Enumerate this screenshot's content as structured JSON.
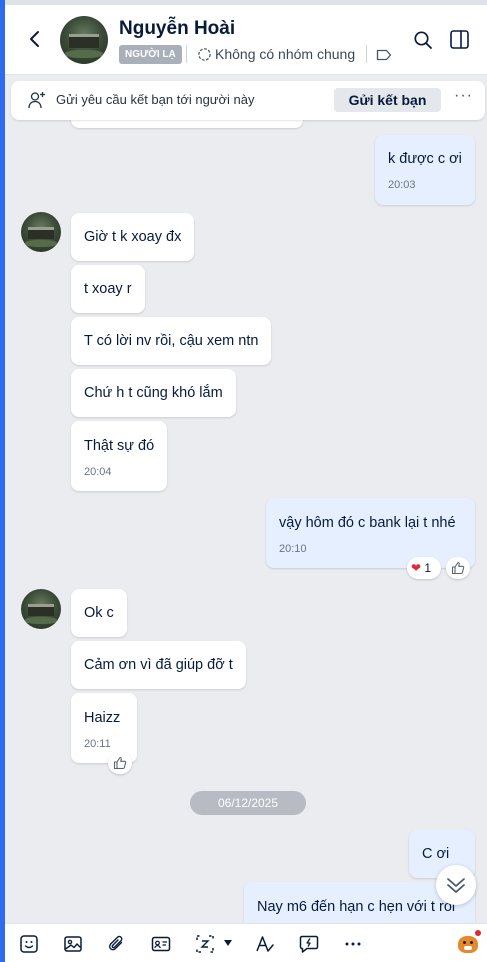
{
  "header": {
    "contact_name": "Nguyễn Hoài",
    "stranger_badge": "NGƯỜI LẠ",
    "common_groups": "Không có nhóm chung"
  },
  "friend_request": {
    "text": "Gửi yêu cầu kết bạn tới người này",
    "button": "Gửi kết bạn",
    "more": "···"
  },
  "messages": {
    "m1": {
      "text": "k được c ơi",
      "time": "20:03"
    },
    "m2": {
      "text": "Giờ t k xoay đx"
    },
    "m3": {
      "text": "t xoay r"
    },
    "m4": {
      "text": "T có lời nv rồi, cậu xem ntn"
    },
    "m5": {
      "text": "Chứ h t cũng khó lắm"
    },
    "m6": {
      "text": "Thật sự đó",
      "time": "20:04"
    },
    "m7": {
      "text": "vậy hôm đó c bank lại t nhé",
      "time": "20:10",
      "reaction_count": "1"
    },
    "m8": {
      "text": "Ok c"
    },
    "m9": {
      "text": "Cảm ơn vì đã giúp đỡ t"
    },
    "m10": {
      "text": "Haizz",
      "time": "20:11"
    },
    "m11": {
      "text": "C ơi"
    },
    "m12": {
      "text": "Nay m6 đến hạn c hẹn với t rồi"
    }
  },
  "date_separator": "06/12/2025",
  "colors": {
    "accent": "#2e6bf0",
    "my_bubble": "#e5efff",
    "their_bubble": "#ffffff",
    "background": "#ebecf0"
  },
  "toolbar_icons": [
    "sticker-icon",
    "image-icon",
    "attach-icon",
    "contact-card-icon",
    "screenshot-icon",
    "text-format-icon",
    "quick-message-icon",
    "more-icon",
    "mascot-icon"
  ]
}
